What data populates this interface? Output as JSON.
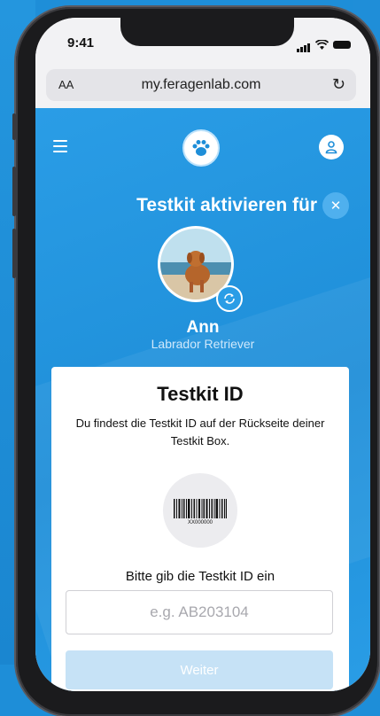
{
  "status_bar": {
    "time": "9:41"
  },
  "browser": {
    "text_size_label": "AA",
    "url": "my.feragenlab.com",
    "reload_icon": "reload-icon"
  },
  "app_header": {
    "menu_icon": "hamburger-icon",
    "logo_icon": "paw-icon",
    "user_icon": "user-icon"
  },
  "activation": {
    "title": "Testkit aktivieren für",
    "close_icon": "close-icon"
  },
  "pet": {
    "name": "Ann",
    "breed": "Labrador Retriever",
    "switch_icon": "refresh-icon"
  },
  "card": {
    "title": "Testkit ID",
    "description": "Du findest die Testkit ID auf der Rückseite deiner Testkit Box.",
    "barcode_number": "XX000000",
    "input_label": "Bitte gib die Testkit ID ein",
    "input_placeholder": "e.g. AB203104",
    "input_value": "",
    "next_label": "Weiter"
  },
  "colors": {
    "primary": "#1e8ed8",
    "button_disabled": "#c6e2f6"
  }
}
